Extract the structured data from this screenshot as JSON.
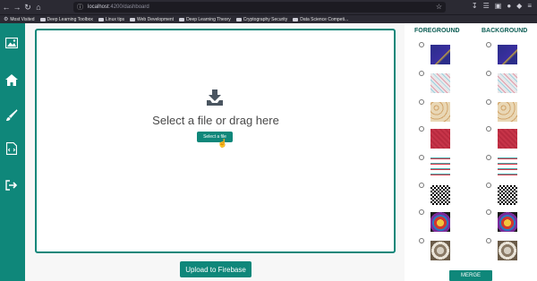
{
  "browser": {
    "url_host": "localhost",
    "url_path": ":4200/dashboard",
    "bookmarks": [
      "Most Visited",
      "Deep Learning Toolbox",
      "Linux tips",
      "Web Development",
      "Deep Learning Theory",
      "Cryptography Security",
      "Data Science Competi..."
    ]
  },
  "sidebar": {
    "items": [
      "image-icon",
      "home-icon",
      "brush-icon",
      "file-code-icon",
      "logout-icon"
    ]
  },
  "dropzone": {
    "text": "Select a file or drag here",
    "button_label": "Select a file"
  },
  "upload": {
    "label": "Upload to Firebase"
  },
  "panel": {
    "foreground_title": "FOREGROUND",
    "background_title": "BACKGROUND",
    "textures": [
      "sea-pattern",
      "heart-pattern",
      "paisley-pattern",
      "red-pattern",
      "knit-pattern",
      "checker-pattern",
      "lion-colorful",
      "lion-gray"
    ],
    "merge_label": "MERGE"
  },
  "colors": {
    "accent": "#0f877a",
    "title": "#0a5c53",
    "chrome": "#2b2a33"
  }
}
